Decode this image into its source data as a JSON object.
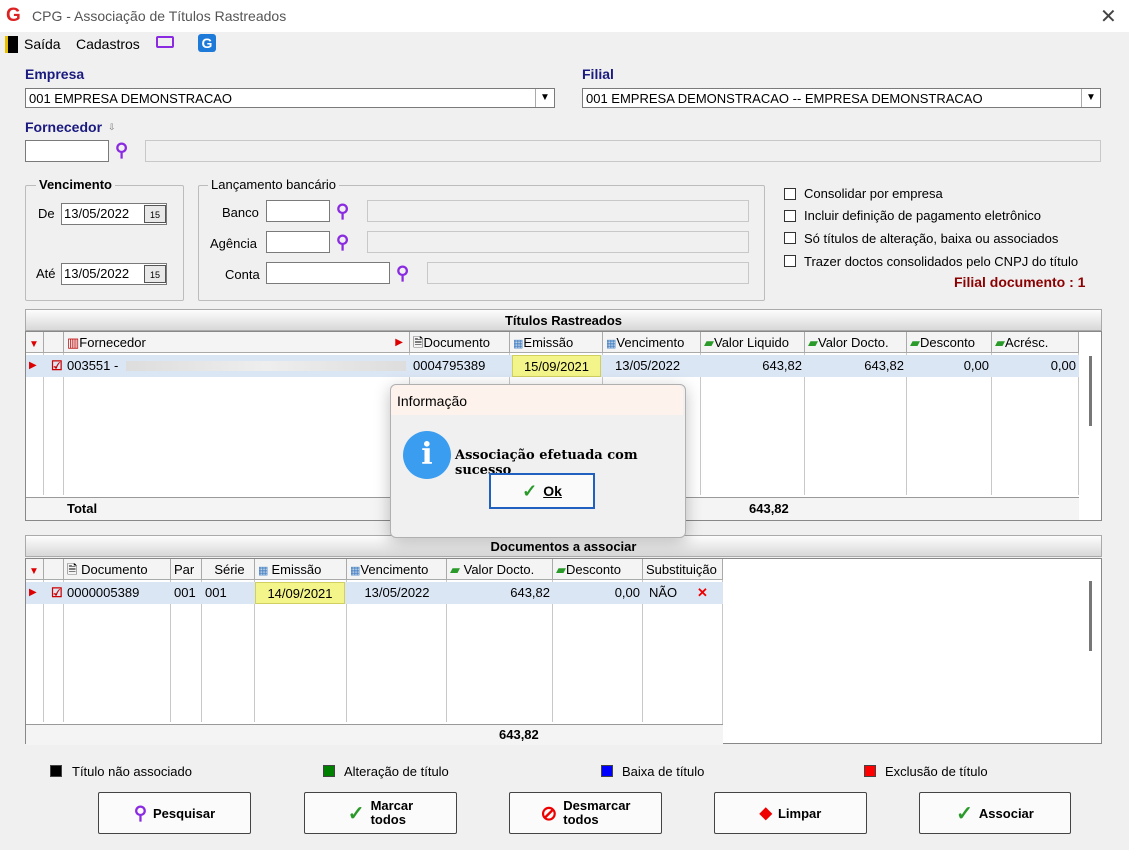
{
  "window": {
    "title": "CPG - Associação de Títulos Rastreados",
    "close": "✕"
  },
  "menu": {
    "saida": "Saída",
    "cadastros": "Cadastros"
  },
  "empresa": {
    "label": "Empresa",
    "value": "001 EMPRESA DEMONSTRACAO"
  },
  "filial": {
    "label": "Filial",
    "value": "001 EMPRESA DEMONSTRACAO -- EMPRESA DEMONSTRACAO"
  },
  "fornecedor": {
    "label": "Fornecedor"
  },
  "vencimento": {
    "title": "Vencimento",
    "de_label": "De",
    "de_value": "13/05/2022",
    "ate_label": "Até",
    "ate_value": "13/05/2022"
  },
  "lancamento": {
    "title": "Lançamento bancário",
    "banco": "Banco",
    "agencia": "Agência",
    "conta": "Conta"
  },
  "options": [
    "Consolidar por empresa",
    "Incluir definição de pagamento eletrônico",
    "Só títulos de alteração, baixa ou associados",
    "Trazer doctos consolidados pelo CNPJ do título"
  ],
  "filial_documento": "Filial documento : 1",
  "titulos": {
    "header": "Títulos Rastreados",
    "columns": [
      "Fornecedor",
      "Documento",
      "Emissão",
      "Vencimento",
      "Valor Liquido",
      "Valor Docto.",
      "Desconto",
      "Acrésc."
    ],
    "row": {
      "fornecedor": "003551 -",
      "documento": "0004795389",
      "emissao": "15/09/2021",
      "vencimento": "13/05/2022",
      "valor_liquido": "643,82",
      "valor_docto": "643,82",
      "desconto": "0,00",
      "acresc": "0,00"
    },
    "total_label": "Total",
    "total_value": "643,82"
  },
  "documentos": {
    "header": "Documentos a associar",
    "columns": [
      "Documento",
      "Par",
      "Série",
      "Emissão",
      "Vencimento",
      "Valor Docto.",
      "Desconto",
      "Substituição"
    ],
    "row": {
      "documento": "0000005389",
      "par": "001",
      "serie": "001",
      "emissao": "14/09/2021",
      "vencimento": "13/05/2022",
      "valor_docto": "643,82",
      "desconto": "0,00",
      "substituicao": "NÃO"
    },
    "total_value": "643,82"
  },
  "legend": [
    {
      "label": "Título não associado",
      "color": "#000000"
    },
    {
      "label": "Alteração de título",
      "color": "#008000"
    },
    {
      "label": "Baixa de título",
      "color": "#0000ff"
    },
    {
      "label": "Exclusão de título",
      "color": "#ff0000"
    }
  ],
  "buttons": {
    "pesquisar": "Pesquisar",
    "marcar_1": "Marcar",
    "marcar_2": "todos",
    "desmarcar_1": "Desmarcar",
    "desmarcar_2": "todos",
    "limpar": "Limpar",
    "associar": "Associar"
  },
  "dialog": {
    "title": "Informação",
    "message": "Associação efetuada com sucesso",
    "ok": "Ok"
  }
}
